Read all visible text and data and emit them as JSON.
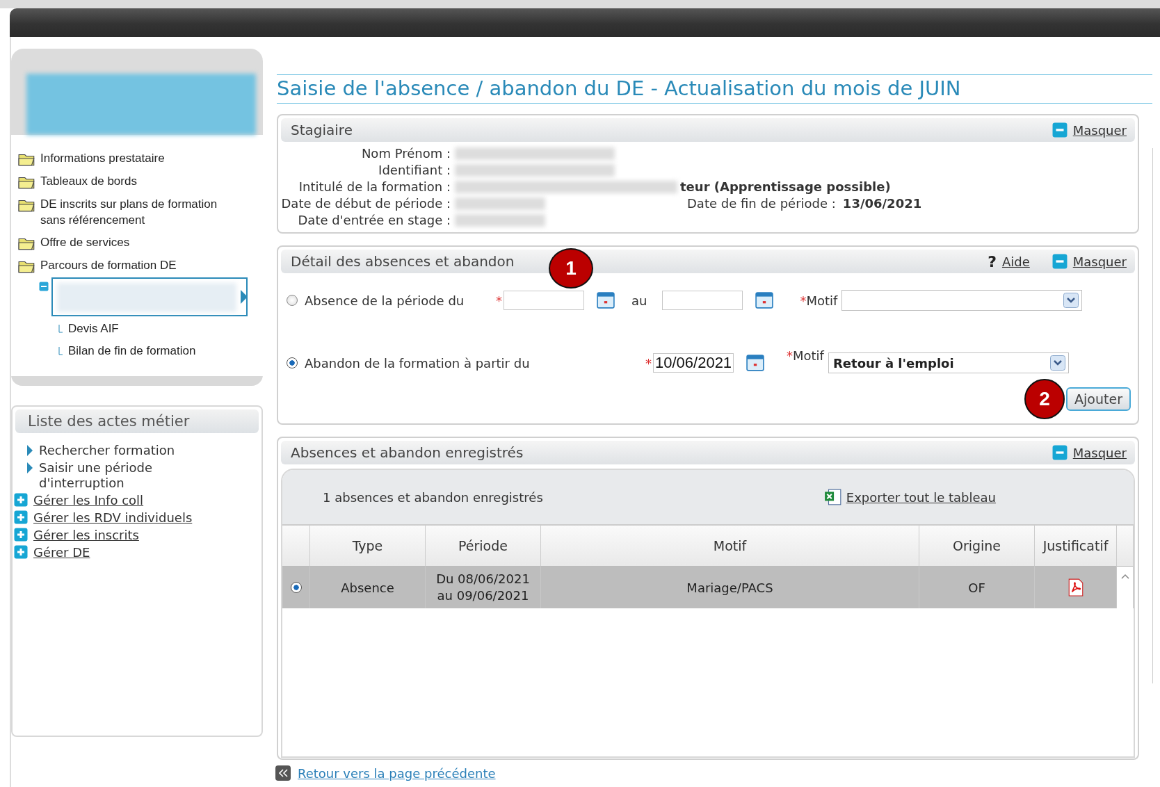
{
  "page_title": "Saisie de l'absence / abandon du DE - Actualisation du mois de JUIN",
  "nav_tree": [
    {
      "label": "Informations prestataire"
    },
    {
      "label": "Tableaux de bords"
    },
    {
      "label": "DE inscrits sur plans de formation sans référencement"
    },
    {
      "label": "Offre de services"
    },
    {
      "label": "Parcours de formation DE",
      "children": [
        {
          "selected": true,
          "expanded": true,
          "children": [
            {
              "label": "Devis AIF"
            },
            {
              "label": "Bilan de fin de formation"
            }
          ]
        }
      ]
    }
  ],
  "actes": {
    "title": "Liste des actes métier",
    "items": [
      {
        "kind": "arrow",
        "label": "Rechercher formation"
      },
      {
        "kind": "arrow",
        "label": "Saisir une période d'interruption"
      },
      {
        "kind": "plus-link",
        "label": "Gérer les Info coll"
      },
      {
        "kind": "plus-link",
        "label": "Gérer les RDV individuels"
      },
      {
        "kind": "plus-link",
        "label": "Gérer les inscrits"
      },
      {
        "kind": "plus-link",
        "label": "Gérer DE"
      }
    ]
  },
  "stagiaire": {
    "title": "Stagiaire",
    "toggle": "Masquer",
    "fields": [
      {
        "label": "Nom Prénom :"
      },
      {
        "label": "Identifiant :"
      },
      {
        "label": "Intitulé de la formation :",
        "value": "teur (Apprentissage possible)"
      },
      {
        "label": "Date de début de période :"
      },
      {
        "label": "Date d'entrée en stage :"
      }
    ],
    "end_label": "Date de fin de période :",
    "end_value": "13/06/2021"
  },
  "detail": {
    "title": "Détail des absences et abandon",
    "help_mark": "?",
    "help": "Aide",
    "toggle": "Masquer",
    "badge": "1",
    "rows": [
      {
        "kind": "period",
        "selected": false,
        "label": "Absence de la période du",
        "start_mark": "*",
        "to_label": "au",
        "motif_mark": "*",
        "motif_label": "Motif"
      },
      {
        "kind": "from",
        "selected": true,
        "label": "Abandon de la formation à partir du",
        "start_mark": "*",
        "start": "10/06/2021",
        "motif_mark": "*",
        "motif_label": "Motif",
        "motif": "Retour à l'emploi"
      }
    ],
    "badge2": "2",
    "add_button": "Ajouter"
  },
  "registered": {
    "title": "Absences et abandon enregistrés",
    "toggle": "Masquer",
    "count": "1 absences et abandon enregistrés",
    "export": "Exporter tout le tableau",
    "columns": [
      "Type",
      "Période",
      "Motif",
      "Origine",
      "Justificatif"
    ],
    "rows": [
      {
        "selected": true,
        "type": "Absence",
        "period": [
          "Du 08/06/2021",
          "au 09/06/2021"
        ],
        "motif": "Mariage/PACS",
        "origine": "OF"
      }
    ]
  },
  "back_link": "Retour vers la page précédente"
}
